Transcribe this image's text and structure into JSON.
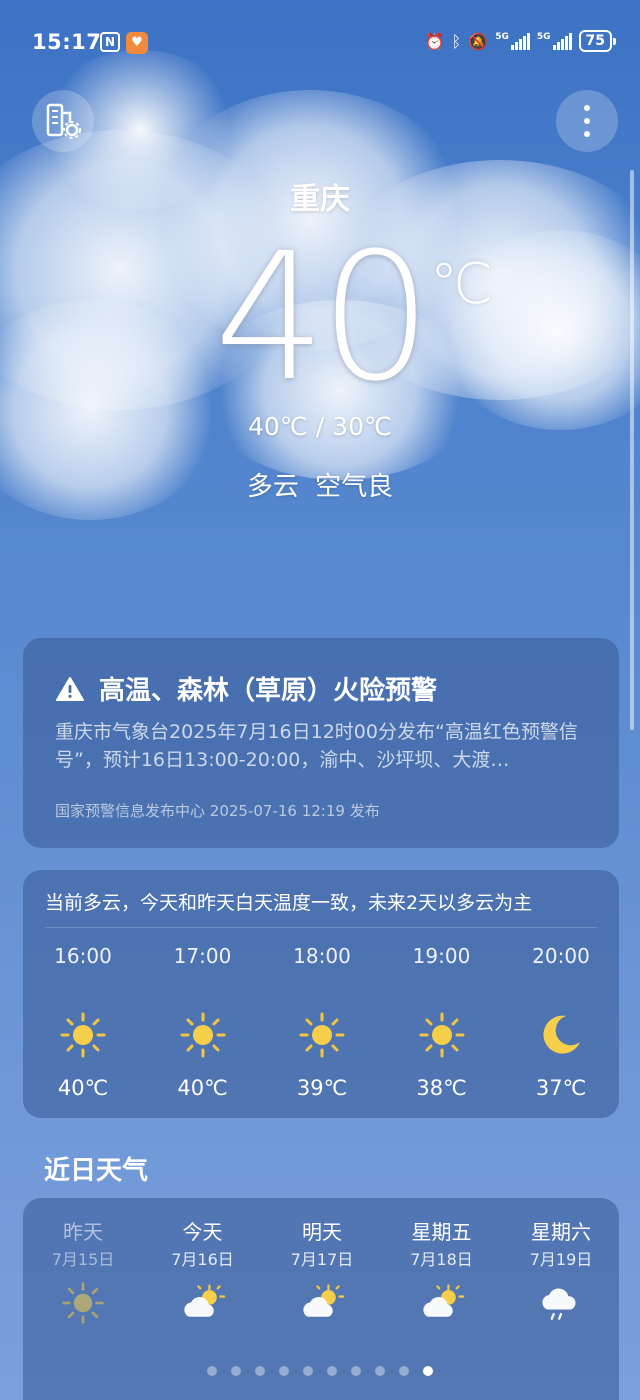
{
  "status_bar": {
    "time": "15:17",
    "signal1": "5G",
    "signal2": "5G",
    "battery": "75"
  },
  "main": {
    "city": "重庆",
    "temperature": "40",
    "unit": "℃",
    "high_low": "40℃ / 30℃",
    "condition": "多云  空气良"
  },
  "alert": {
    "icon": "warning-icon",
    "title": "高温、森林（草原）火险预警",
    "body": "重庆市气象台2025年7月16日12时00分发布“高温红色预警信号”，预计16日13:00-20:00，渝中、沙坪坝、大渡…",
    "source": "国家预警信息发布中心 2025-07-16 12:19 发布"
  },
  "hourly": {
    "summary": "当前多云，今天和昨天白天温度一致，未来2天以多云为主",
    "items": [
      {
        "time": "16:00",
        "icon": "sun-icon",
        "temp": "40℃"
      },
      {
        "time": "17:00",
        "icon": "sun-icon",
        "temp": "40℃"
      },
      {
        "time": "18:00",
        "icon": "sun-icon",
        "temp": "39℃"
      },
      {
        "time": "19:00",
        "icon": "sun-icon",
        "temp": "38℃"
      },
      {
        "time": "20:00",
        "icon": "moon-icon",
        "temp": "37℃"
      }
    ]
  },
  "recent": {
    "title": "近日天气",
    "days": [
      {
        "name": "昨天",
        "date": "7月15日",
        "icon": "sun-icon"
      },
      {
        "name": "今天",
        "date": "7月16日",
        "icon": "partly-cloudy-icon"
      },
      {
        "name": "明天",
        "date": "7月17日",
        "icon": "partly-cloudy-icon"
      },
      {
        "name": "星期五",
        "date": "7月18日",
        "icon": "partly-cloudy-icon"
      },
      {
        "name": "星期六",
        "date": "7月19日",
        "icon": "rain-icon"
      }
    ]
  },
  "pager": {
    "count": 10,
    "active": 9
  }
}
